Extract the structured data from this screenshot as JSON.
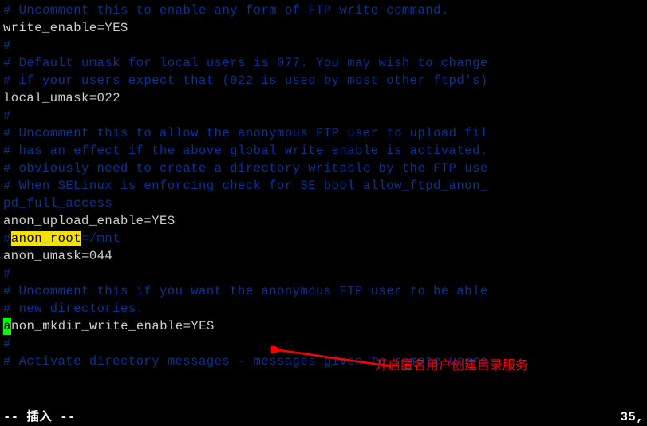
{
  "lines": [
    {
      "segments": [
        {
          "cls": "comment",
          "text": "# Uncomment this to enable any form of FTP write command."
        }
      ]
    },
    {
      "segments": [
        {
          "cls": "normal",
          "text": "write_enable=YES"
        }
      ]
    },
    {
      "segments": [
        {
          "cls": "comment",
          "text": "#"
        }
      ]
    },
    {
      "segments": [
        {
          "cls": "comment",
          "text": "# Default umask for local users is 077. You may wish to change"
        }
      ]
    },
    {
      "segments": [
        {
          "cls": "comment",
          "text": "# if your users expect that (022 is used by most other ftpd's)"
        }
      ]
    },
    {
      "segments": [
        {
          "cls": "normal",
          "text": "local_umask=022"
        }
      ]
    },
    {
      "segments": [
        {
          "cls": "comment",
          "text": "#"
        }
      ]
    },
    {
      "segments": [
        {
          "cls": "comment",
          "text": "# Uncomment this to allow the anonymous FTP user to upload fil"
        }
      ]
    },
    {
      "segments": [
        {
          "cls": "comment",
          "text": "# has an effect if the above global write enable is activated."
        }
      ]
    },
    {
      "segments": [
        {
          "cls": "comment",
          "text": "# obviously need to create a directory writable by the FTP use"
        }
      ]
    },
    {
      "segments": [
        {
          "cls": "comment",
          "text": "# When SELinux is enforcing check for SE bool allow_ftpd_anon_"
        },
        {
          "cls": "normal",
          "text": ""
        }
      ]
    },
    {
      "segments": [
        {
          "cls": "comment",
          "text": "pd_full_access"
        }
      ]
    },
    {
      "segments": [
        {
          "cls": "normal",
          "text": "anon_upload_enable=YES"
        }
      ]
    },
    {
      "segments": [
        {
          "cls": "comment",
          "text": "#"
        },
        {
          "cls": "search-hl",
          "text": "anon_root"
        },
        {
          "cls": "comment",
          "text": "=/mnt"
        }
      ]
    },
    {
      "segments": [
        {
          "cls": "normal",
          "text": "anon_umask=044"
        }
      ]
    },
    {
      "segments": [
        {
          "cls": "comment",
          "text": "#"
        }
      ]
    },
    {
      "segments": [
        {
          "cls": "comment",
          "text": "# Uncomment this if you want the anonymous FTP user to be able"
        }
      ]
    },
    {
      "segments": [
        {
          "cls": "comment",
          "text": "# new directories."
        }
      ]
    },
    {
      "segments": [
        {
          "cls": "cursor-cell",
          "text": "a"
        },
        {
          "cls": "normal",
          "text": "non_mkdir_write_enable=YES"
        }
      ]
    },
    {
      "segments": [
        {
          "cls": "comment",
          "text": "#"
        }
      ]
    },
    {
      "segments": [
        {
          "cls": "comment",
          "text": "# Activate directory messages - messages given to remote users"
        }
      ]
    }
  ],
  "status": {
    "mode": "-- 插入 --",
    "position": "35,"
  },
  "annotation": {
    "text": "开启匿名用户创建目录服务",
    "arrow_color": "#ff0000"
  }
}
